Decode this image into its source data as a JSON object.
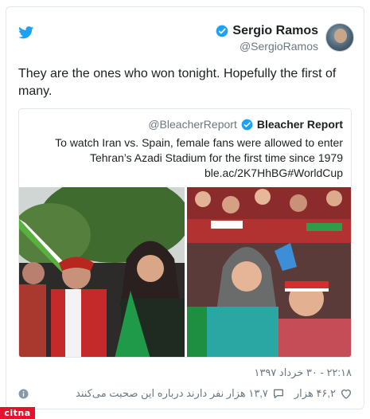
{
  "author": {
    "name": "Sergio Ramos",
    "handle": "@SergioRamos"
  },
  "tweet": {
    "text": "They are the ones who won tonight. Hopefully the first of many."
  },
  "quoted": {
    "handle": "@BleacherReport",
    "name": "Bleacher Report",
    "line1": "To watch Iran vs. Spain, female fans were allowed to enter",
    "line2": "Tehran’s Azadi Stadium for the first time since 1979",
    "line3": "ble.ac/2K7HhBG#WorldCup"
  },
  "footer": {
    "timestamp": "۲۲:۱۸ - ۳۰ خرداد ۱۳۹۷",
    "likes": "۴۶,۲ هزار",
    "replies_count": "۱۳,۷ هزار نفر دارند درباره این صحبت می‌کنند"
  },
  "watermark": {
    "text": "citna"
  },
  "icons": {
    "brand": "twitter-bird-icon",
    "verified": "verified-badge-icon",
    "like": "heart-icon",
    "reply": "speech-bubble-icon",
    "info": "info-icon"
  },
  "colors": {
    "twitter_blue": "#1da1f2",
    "text": "#1c2022",
    "muted": "#697882",
    "border": "#e1e8ed",
    "watermark_red": "#e8102c"
  }
}
